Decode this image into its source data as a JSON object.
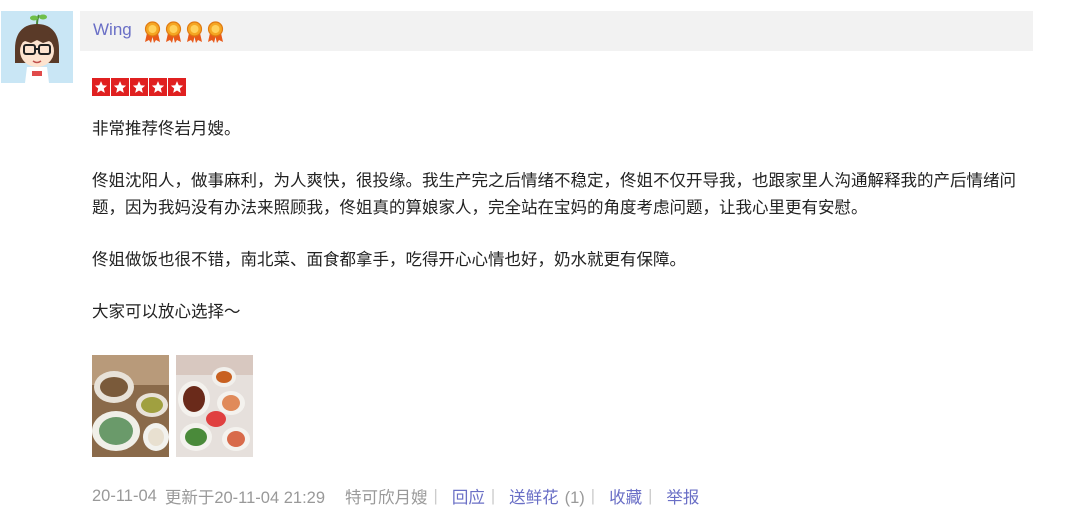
{
  "user": {
    "name": "Wing",
    "medal_count": 4,
    "medal_icon": "medal-icon",
    "medal_color": "#f07a1a"
  },
  "rating": {
    "stars": 5,
    "max": 5,
    "color": "#e02020"
  },
  "review": {
    "paragraphs": [
      "非常推荐佟岩月嫂。",
      "佟姐沈阳人，做事麻利，为人爽快，很投缘。我生产完之后情绪不稳定，佟姐不仅开导我，也跟家里人沟通解释我的产后情绪问题，因为我妈没有办法来照顾我，佟姐真的算娘家人，完全站在宝妈的角度考虑问题，让我心里更有安慰。",
      "佟姐做饭也很不错，南北菜、面食都拿手，吃得开心心情也好，奶水就更有保障。",
      "大家可以放心选择～"
    ]
  },
  "footer": {
    "date": "20-11-04",
    "updated": "更新于20-11-04 21:29",
    "target": "特可欣月嫂",
    "reply": "回应",
    "flowers": "送鲜花",
    "flower_count": "(1)",
    "favorite": "收藏",
    "report": "举报",
    "separator": "|"
  },
  "colors": {
    "link": "#6a6fc6",
    "muted": "#999999",
    "header_bg": "#f2f2f2"
  }
}
